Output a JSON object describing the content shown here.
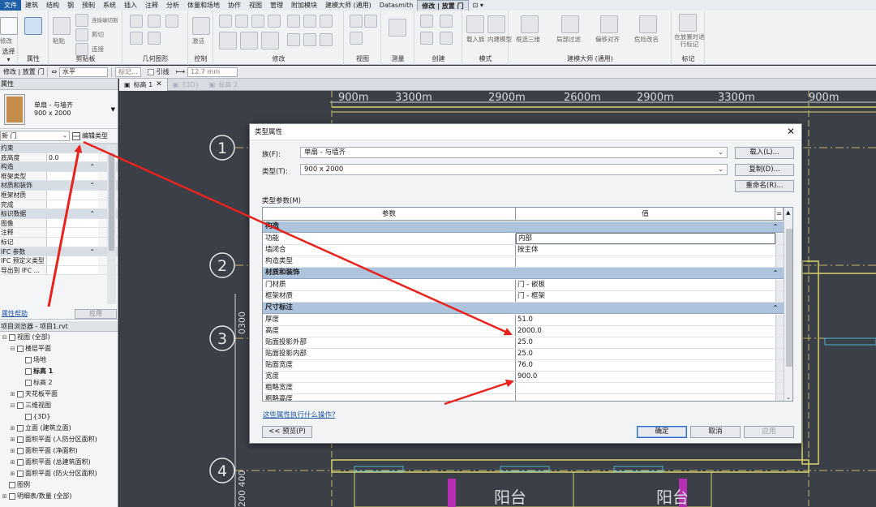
{
  "menu": {
    "tabs": [
      "文件",
      "建筑",
      "结构",
      "钢",
      "预制",
      "系统",
      "插入",
      "注释",
      "分析",
      "体量和场地",
      "协作",
      "视图",
      "管理",
      "附加模块",
      "建模大师 (通用)",
      "Datasmith",
      "修改 | 放置 门"
    ],
    "active_tab": "修改 | 放置 门"
  },
  "ribbon": {
    "groups": [
      "选择 ▾",
      "属性",
      "剪贴板",
      "几何图形",
      "控制",
      "修改",
      "视图",
      "测量",
      "创建",
      "模式",
      "建模大师 (通用)",
      "标记"
    ],
    "labels": [
      "修改",
      "粘贴",
      "连接端切割",
      "剪切",
      "连接",
      "激活",
      "载入族",
      "内建模型",
      "框选三维",
      "局部过滤",
      "偏移对齐",
      "危险改名",
      "在放置时进行标记"
    ]
  },
  "optbar": {
    "context": "修改 | 放置 门",
    "orientation": "水平",
    "tag_label": "标记...",
    "leader_label": "引线",
    "leader_length": "12.7 mm"
  },
  "properties": {
    "title": "属性",
    "type_name_1": "单扇 - 与墙齐",
    "type_name_2": "900 x 2000",
    "instance_filter": "新 门",
    "edit_type_label": "编辑类型",
    "rows": [
      {
        "k": "约束",
        "v": "",
        "hdr": true
      },
      {
        "k": "底高度",
        "v": "0.0"
      },
      {
        "k": "构造",
        "v": "",
        "hdr": true
      },
      {
        "k": "框架类型",
        "v": ""
      },
      {
        "k": "材质和装饰",
        "v": "",
        "hdr": true
      },
      {
        "k": "框架材质",
        "v": ""
      },
      {
        "k": "完成",
        "v": ""
      },
      {
        "k": "标识数据",
        "v": "",
        "hdr": true
      },
      {
        "k": "图像",
        "v": ""
      },
      {
        "k": "注释",
        "v": ""
      },
      {
        "k": "标记",
        "v": ""
      },
      {
        "k": "IFC 参数",
        "v": "",
        "hdr": true
      },
      {
        "k": "IFC 预定义类型",
        "v": ""
      },
      {
        "k": "导出到 IFC ...",
        "v": ""
      }
    ],
    "help_link": "属性帮助",
    "apply_label": "应用"
  },
  "browser": {
    "title": "项目浏览器 - 项目1.rvt",
    "nodes": [
      {
        "label": "视图 (全部)",
        "indent": 0,
        "tog": "⊟"
      },
      {
        "label": "楼层平面",
        "indent": 1,
        "tog": "⊟"
      },
      {
        "label": "场地",
        "indent": 2,
        "tog": ""
      },
      {
        "label": "标高 1",
        "indent": 2,
        "tog": "",
        "bold": true
      },
      {
        "label": "标高 2",
        "indent": 2,
        "tog": ""
      },
      {
        "label": "天花板平面",
        "indent": 1,
        "tog": "⊞"
      },
      {
        "label": "三维视图",
        "indent": 1,
        "tog": "⊟"
      },
      {
        "label": "{3D}",
        "indent": 2,
        "tog": ""
      },
      {
        "label": "立面 (建筑立面)",
        "indent": 1,
        "tog": "⊞"
      },
      {
        "label": "面积平面 (人防分区面积)",
        "indent": 1,
        "tog": "⊞"
      },
      {
        "label": "面积平面 (净面积)",
        "indent": 1,
        "tog": "⊞"
      },
      {
        "label": "面积平面 (总建筑面积)",
        "indent": 1,
        "tog": "⊞"
      },
      {
        "label": "面积平面 (防火分区面积)",
        "indent": 1,
        "tog": "⊞"
      },
      {
        "label": "图例",
        "indent": 0,
        "tog": ""
      },
      {
        "label": "明细表/数量 (全部)",
        "indent": 0,
        "tog": "⊞"
      }
    ]
  },
  "canvas": {
    "tabs": [
      {
        "label": "标高 1",
        "active": true
      },
      {
        "label": "{3D}",
        "active": false
      },
      {
        "label": "标高 2",
        "active": false
      }
    ],
    "dims_top": [
      "900m",
      "3300m",
      "2900m",
      "2600m",
      "2900m",
      "3300m",
      "900m"
    ],
    "grid_bubbles": [
      "1",
      "2",
      "3",
      "4"
    ],
    "room_labels": [
      "阳台",
      "阳台"
    ],
    "left_dims": [
      "0300",
      "200 400"
    ]
  },
  "dialog": {
    "title": "类型属性",
    "family_label": "族(F):",
    "family_value": "单扇 - 与墙齐",
    "type_label": "类型(T):",
    "type_value": "900 x 2000",
    "load_btn": "载入(L)...",
    "duplicate_btn": "复制(D)...",
    "rename_btn": "重命名(R)...",
    "params_label": "类型参数(M)",
    "col_param": "参数",
    "col_value": "值",
    "rows": [
      {
        "k": "构造",
        "sec": true
      },
      {
        "k": "功能",
        "v": "内部",
        "box": true
      },
      {
        "k": "墙闭合",
        "v": "按主体"
      },
      {
        "k": "构造类型",
        "v": ""
      },
      {
        "k": "材质和装饰",
        "sec": true
      },
      {
        "k": "门材质",
        "v": "门 - 嵌板"
      },
      {
        "k": "框架材质",
        "v": "门 - 框架"
      },
      {
        "k": "尺寸标注",
        "sec": true
      },
      {
        "k": "厚度",
        "v": "51.0"
      },
      {
        "k": "高度",
        "v": "2000.0"
      },
      {
        "k": "贴面投影外部",
        "v": "25.0"
      },
      {
        "k": "贴面投影内部",
        "v": "25.0"
      },
      {
        "k": "贴面宽度",
        "v": "76.0"
      },
      {
        "k": "宽度",
        "v": "900.0"
      },
      {
        "k": "粗略宽度",
        "v": ""
      },
      {
        "k": "粗略高度",
        "v": ""
      }
    ],
    "help_link": "这些属性执行什么操作?",
    "preview_btn": "<< 预览(P)",
    "ok_btn": "确定",
    "cancel_btn": "取消",
    "apply_btn": "应用"
  },
  "colors": {
    "arrow": "#e8231e",
    "section_header": "#aec4dd",
    "canvas_bg": "#3b3f47",
    "wall_line": "#d9d36a"
  }
}
